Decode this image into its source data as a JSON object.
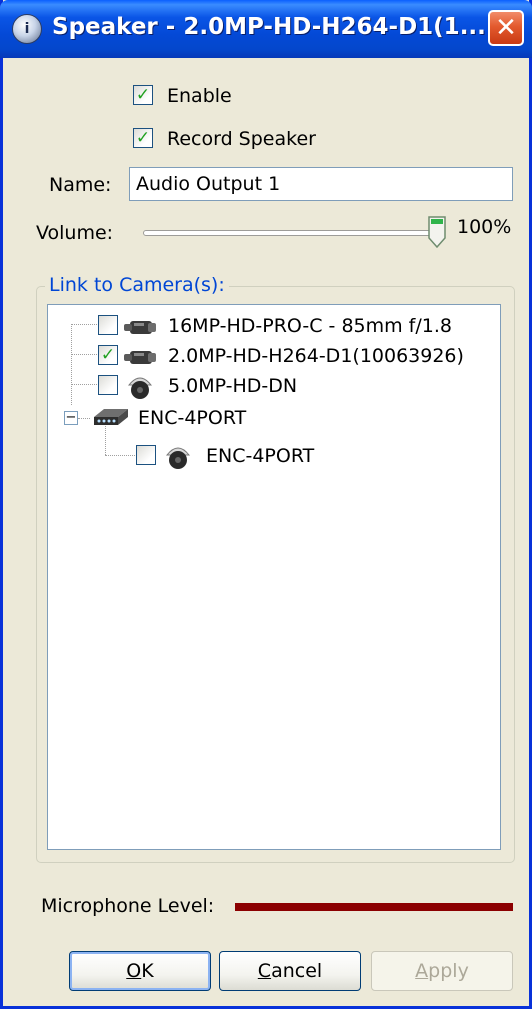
{
  "window": {
    "title": "Speaker - 2.0MP-HD-H264-D1(1...",
    "close_glyph": "✕"
  },
  "form": {
    "enable": {
      "label": "Enable",
      "checked": true
    },
    "record_speaker": {
      "label": "Record Speaker",
      "checked": true
    },
    "name_label": "Name:",
    "name_value": "Audio Output 1",
    "volume_label": "Volume:",
    "volume_value": "100%",
    "volume_level": 1.0
  },
  "cameras": {
    "group_title": "Link to Camera(s):",
    "items": [
      {
        "label": "16MP-HD-PRO-C - 85mm f/1.8",
        "checked": false,
        "icon": "box-camera-icon"
      },
      {
        "label": "2.0MP-HD-H264-D1(10063926)",
        "checked": true,
        "icon": "box-camera-icon"
      },
      {
        "label": "5.0MP-HD-DN",
        "checked": false,
        "icon": "dome-camera-icon"
      },
      {
        "label": "ENC-4PORT",
        "icon": "encoder-icon",
        "expanded": true,
        "expander": "−"
      },
      {
        "label": "ENC-4PORT",
        "checked": false,
        "icon": "dome-camera-icon"
      }
    ]
  },
  "microphone": {
    "label": "Microphone Level:",
    "color": "#8B0000"
  },
  "buttons": {
    "ok": {
      "accel": "O",
      "rest": "K"
    },
    "cancel": {
      "accel": "C",
      "rest": "ancel"
    },
    "apply": {
      "accel": "A",
      "rest": "pply"
    }
  },
  "colors": {
    "titlebar": "#0449D6",
    "group_title": "#0046D5",
    "check": "#21A121"
  }
}
